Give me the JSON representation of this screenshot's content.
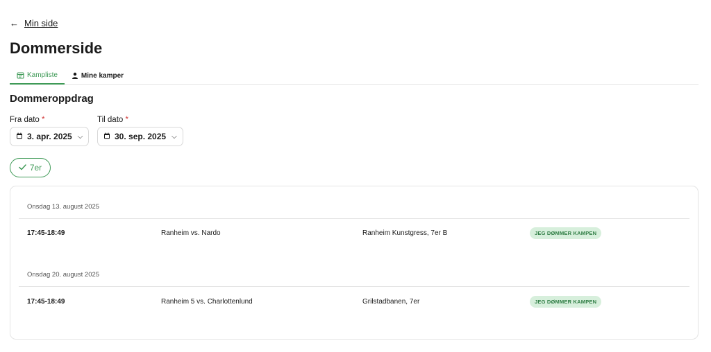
{
  "nav": {
    "back_label": "Min side"
  },
  "page": {
    "title": "Dommerside"
  },
  "tabs": [
    {
      "label": "Kampliste",
      "icon": "calendar-icon",
      "active": true
    },
    {
      "label": "Mine kamper",
      "icon": "person-icon",
      "active": false
    }
  ],
  "section": {
    "title": "Dommeroppdrag"
  },
  "filters": {
    "from": {
      "label": "Fra dato",
      "required_mark": "*",
      "value": "3. apr. 2025"
    },
    "to": {
      "label": "Til dato",
      "required_mark": "*",
      "value": "30. sep. 2025"
    },
    "chip": {
      "label": "7er",
      "selected": true
    }
  },
  "schedule": [
    {
      "day": "Onsdag 13. august 2025",
      "matches": [
        {
          "time": "17:45-18:49",
          "teams": "Ranheim vs. Nardo",
          "venue": "Ranheim Kunstgress, 7er B",
          "status": "JEG DØMMER KAMPEN"
        }
      ]
    },
    {
      "day": "Onsdag 20. august 2025",
      "matches": [
        {
          "time": "17:45-18:49",
          "teams": "Ranheim 5 vs. Charlottenlund",
          "venue": "Grilstadbanen, 7er",
          "status": "JEG DØMMER KAMPEN"
        }
      ]
    }
  ],
  "colors": {
    "accent": "#3f9a57",
    "badge_bg": "#d7efdc",
    "badge_text": "#2f7d44",
    "required": "#d23c3c"
  }
}
